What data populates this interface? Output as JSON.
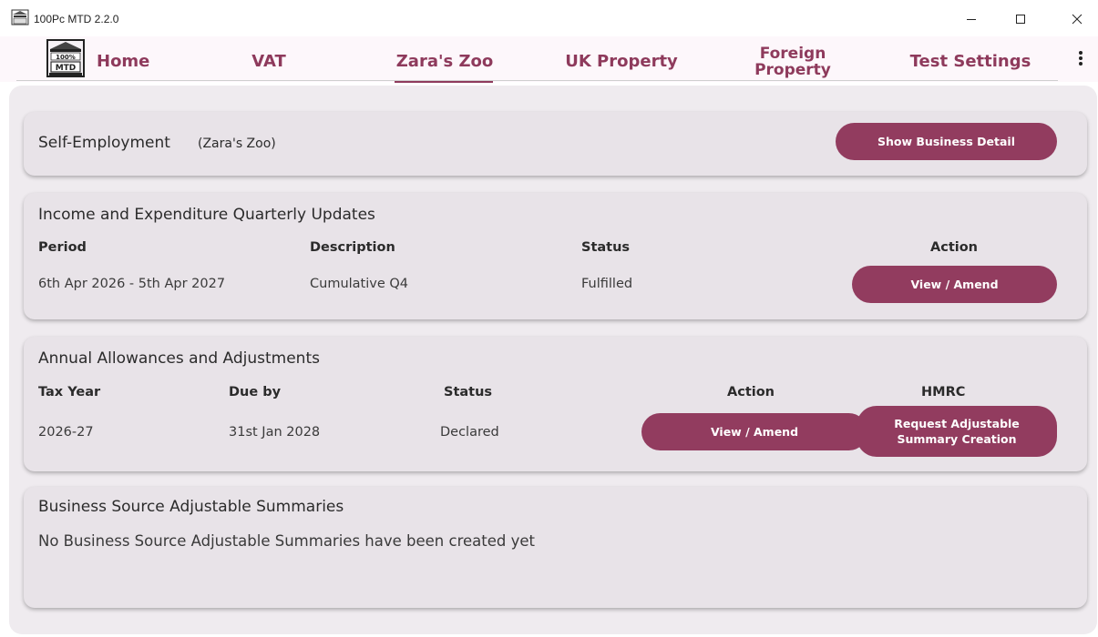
{
  "window": {
    "title": "100Pc MTD 2.2.0"
  },
  "nav": {
    "logo_text": "100% MTD",
    "items": [
      {
        "label": "Home"
      },
      {
        "label": "VAT"
      },
      {
        "label": "Zara's Zoo"
      },
      {
        "label": "UK Property"
      },
      {
        "label": "Foreign Property"
      },
      {
        "label": "Test Settings"
      }
    ],
    "active": "Zara's Zoo"
  },
  "self_employment": {
    "title": "Self-Employment",
    "business_name": "(Zara's Zoo)",
    "button_label": "Show Business Detail"
  },
  "quarterly": {
    "title": "Income and Expenditure Quarterly Updates",
    "headers": [
      "Period",
      "Description",
      "Status",
      "Action"
    ],
    "rows": [
      {
        "period": "6th Apr 2026 - 5th Apr 2027",
        "description": "Cumulative Q4",
        "status": "Fulfilled",
        "action": "View / Amend"
      }
    ]
  },
  "annual": {
    "title": "Annual Allowances and Adjustments",
    "headers": [
      "Tax Year",
      "Due by",
      "Status",
      "Action",
      "HMRC"
    ],
    "rows": [
      {
        "tax_year": "2026-27",
        "due_by": "31st Jan 2028",
        "status": "Declared",
        "action": "View / Amend",
        "hmrc": "Request Adjustable Summary Creation"
      }
    ]
  },
  "summaries": {
    "title": "Business Source Adjustable Summaries",
    "empty_text": "No Business Source Adjustable Summaries have been created yet"
  },
  "colors": {
    "accent": "#923c5f",
    "nav_text": "#8e3a5c",
    "panel": "#efebef",
    "card": "#e8e3e8"
  }
}
